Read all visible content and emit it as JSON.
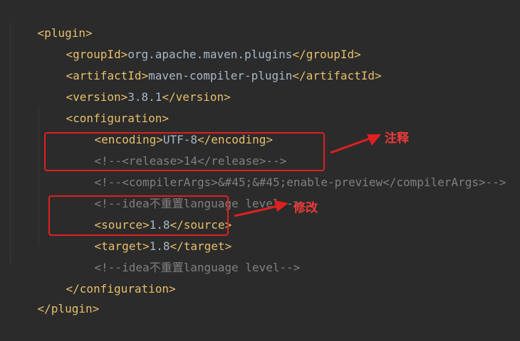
{
  "lines": [
    {
      "text": "<plugin>"
    },
    {
      "open": "<groupId>",
      "value": "org.apache.maven.plugins",
      "close": "</groupId>"
    },
    {
      "open": "<artifactId>",
      "value": "maven-compiler-plugin",
      "close": "</artifactId>"
    },
    {
      "open": "<version>",
      "value": "3.8.1",
      "close": "</version>"
    },
    {
      "text": "<configuration>"
    },
    {
      "open": "<encoding>",
      "value": "UTF-8",
      "close": "</encoding>"
    },
    {
      "cstart": "<!--",
      "open": "<release>",
      "value": "14",
      "close": "</release>",
      "cend": "-->"
    },
    {
      "cstart": "<!--",
      "open": "<compilerArgs>",
      "value": "&#45;&#45;enable-preview",
      "close": "</compilerArgs>",
      "cend": "-->"
    },
    {
      "text": "<!--idea不重置language level-->"
    },
    {
      "open": "<source>",
      "value": "1.8",
      "close": "</source>"
    },
    {
      "open": "<target>",
      "value": "1.8",
      "close": "</target>"
    },
    {
      "text": "<!--idea不重置language level-->"
    },
    {
      "text": "</configuration>"
    },
    {
      "text": "</plugin>"
    }
  ],
  "annotations": {
    "comment_label": "注释",
    "modify_label": "修改"
  },
  "colors": {
    "background": "#2b2b2b",
    "tag": "#e8bf6a",
    "text": "#a9b7c6",
    "comment": "#808080",
    "annotation_red": "#e02020"
  }
}
